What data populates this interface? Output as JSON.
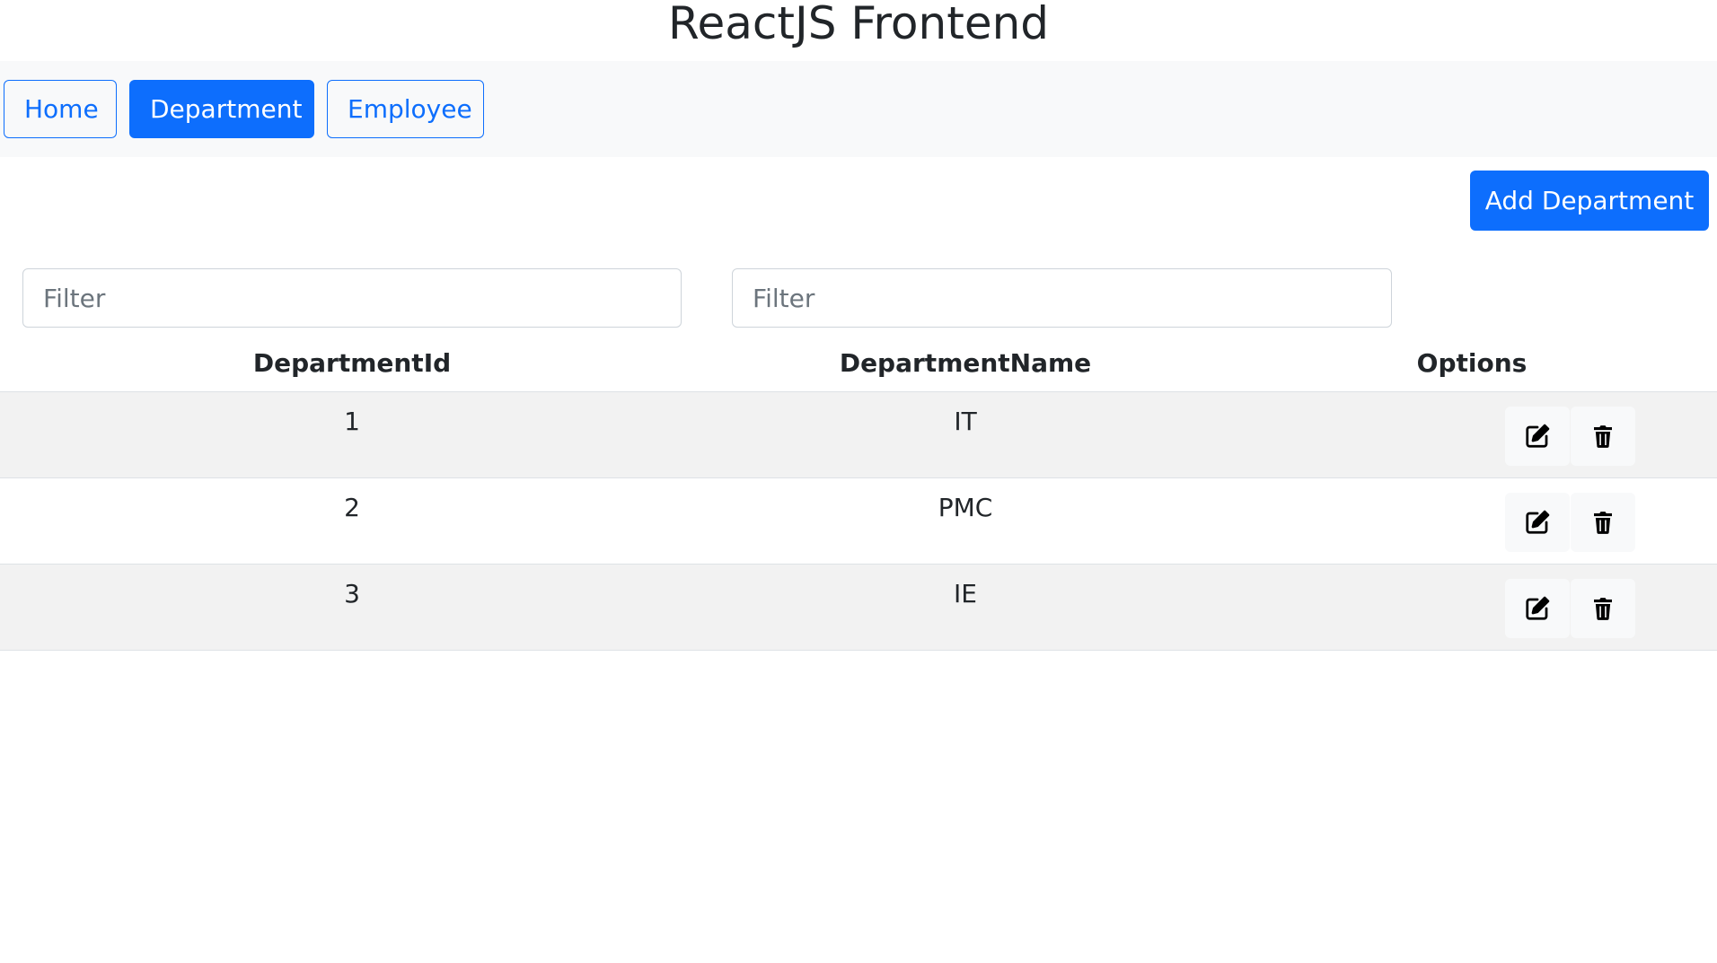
{
  "app": {
    "title": "ReactJS Frontend"
  },
  "nav": {
    "home": "Home",
    "department": "Department",
    "employee": "Employee",
    "active": "Department"
  },
  "actions": {
    "add_department": "Add Department"
  },
  "filters": {
    "department_id_placeholder": "Filter",
    "department_name_placeholder": "Filter"
  },
  "table": {
    "headers": {
      "department_id": "DepartmentId",
      "department_name": "DepartmentName",
      "options": "Options"
    },
    "rows": [
      {
        "id": "1",
        "name": "IT"
      },
      {
        "id": "2",
        "name": "PMC"
      },
      {
        "id": "3",
        "name": "IE"
      }
    ]
  },
  "icons": {
    "edit": "edit-icon",
    "delete": "trash-icon"
  },
  "colors": {
    "primary": "#0d6efd",
    "navbar_bg": "#f8f9fa",
    "stripe": "#f2f2f2",
    "icon_button_bg": "#f8f9fa"
  }
}
